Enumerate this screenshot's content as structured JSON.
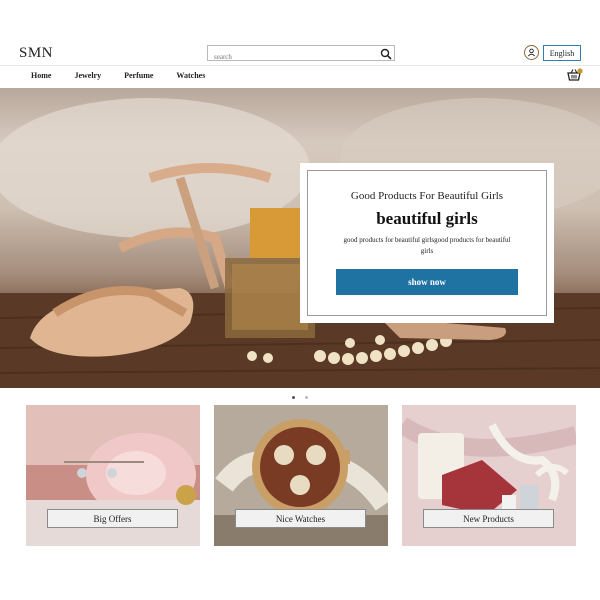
{
  "header": {
    "logo": "SMN",
    "search_placeholder": "search",
    "language_label": "English"
  },
  "nav": {
    "items": [
      {
        "label": "Home"
      },
      {
        "label": "Jewelry"
      },
      {
        "label": "Perfume"
      },
      {
        "label": "Watches"
      }
    ]
  },
  "cart": {
    "badge": "0"
  },
  "hero": {
    "subtitle": "Good Products For Beautiful Girls",
    "title": "beautiful girls",
    "description": "good products for beautiful girlsgood products for beautiful girls",
    "button_label": "show now"
  },
  "tiles": [
    {
      "label": "Big Offers"
    },
    {
      "label": "Nice Watches"
    },
    {
      "label": "New Products"
    }
  ],
  "colors": {
    "accent": "#1e73a3",
    "border": "#2f7fb0"
  }
}
